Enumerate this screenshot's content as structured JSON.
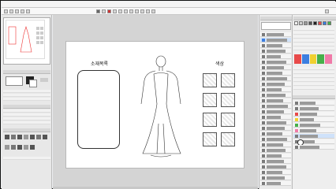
{
  "canvas": {
    "materials_title": "소재목록",
    "colors_title": "색상"
  },
  "colors": {
    "accent_blue": "#3c7ee0",
    "swatch_red": "#e84a4a",
    "swatch_yellow": "#f0d030",
    "swatch_pink": "#f07aa8",
    "swatch_green": "#46b04a"
  },
  "icons": [
    "menu-icon",
    "brush-icon",
    "eraser-icon",
    "layer-icon",
    "eye-icon"
  ]
}
